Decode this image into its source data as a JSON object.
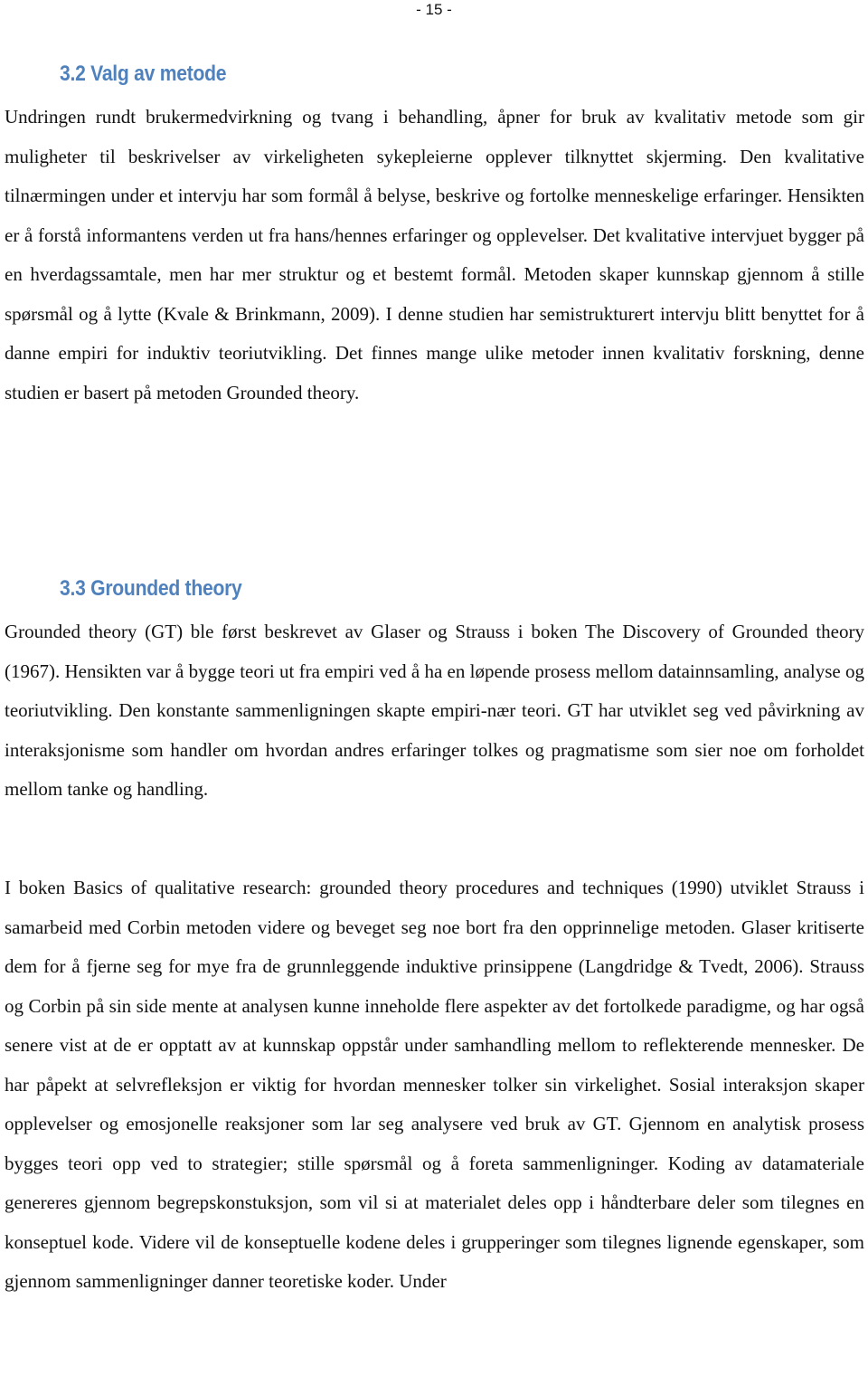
{
  "page": {
    "page_number": "- 15 -"
  },
  "sections": [
    {
      "heading": "3.2 Valg av metode",
      "paragraphs": [
        "Undringen rundt brukermedvirkning og tvang i behandling, åpner for bruk av kvalitativ metode som gir muligheter til beskrivelser av virkeligheten sykepleierne opplever tilknyttet skjerming. Den kvalitative tilnærmingen under et intervju har som formål å belyse, beskrive og fortolke menneskelige erfaringer. Hensikten er å forstå informantens verden ut fra hans/hennes erfaringer og opplevelser. Det kvalitative intervjuet bygger på en hverdagssamtale, men har mer struktur og et bestemt formål. Metoden skaper kunnskap gjennom å stille spørsmål og å lytte (Kvale & Brinkmann, 2009). I denne studien har semistrukturert intervju blitt benyttet for å danne empiri for induktiv teoriutvikling. Det finnes mange ulike metoder innen kvalitativ forskning, denne studien er basert på metoden Grounded theory."
      ]
    },
    {
      "heading": "3.3 Grounded theory",
      "paragraphs": [
        "Grounded theory (GT) ble først beskrevet av Glaser og Strauss i boken The Discovery of Grounded theory (1967). Hensikten var å bygge teori ut fra empiri ved å ha en løpende prosess mellom datainnsamling, analyse og teoriutvikling. Den konstante sammenligningen skapte empiri-nær teori. GT har utviklet seg ved påvirkning av interaksjonisme som handler om hvordan andres erfaringer tolkes og pragmatisme som sier noe om forholdet mellom tanke og handling.",
        "I boken Basics of qualitative research: grounded theory procedures and techniques (1990) utviklet Strauss i samarbeid med Corbin metoden videre og beveget seg noe bort fra den opprinnelige metoden. Glaser kritiserte dem for å fjerne seg for mye fra de grunnleggende induktive prinsippene (Langdridge & Tvedt, 2006). Strauss og Corbin på sin side mente at analysen kunne inneholde flere aspekter av det fortolkede paradigme, og har også senere vist at de er opptatt av at kunnskap oppstår under samhandling mellom to reflekterende mennesker. De har påpekt at selvrefleksjon er viktig for hvordan mennesker tolker sin virkelighet. Sosial interaksjon skaper opplevelser og emosjonelle reaksjoner som lar seg analysere ved bruk av GT. Gjennom en analytisk prosess bygges teori opp ved to strategier; stille spørsmål og å foreta sammenligninger. Koding av datamateriale genereres gjennom begrepskonstuksjon, som vil si at materialet deles opp i håndterbare deler som tilegnes en konseptuel kode. Videre vil de konseptuelle kodene deles i grupperinger som tilegnes lignende egenskaper, som gjennom sammenligninger danner teoretiske koder. Under"
      ]
    }
  ],
  "colors": {
    "heading": "#4f81bd",
    "body_text": "#111111",
    "background": "#ffffff"
  }
}
